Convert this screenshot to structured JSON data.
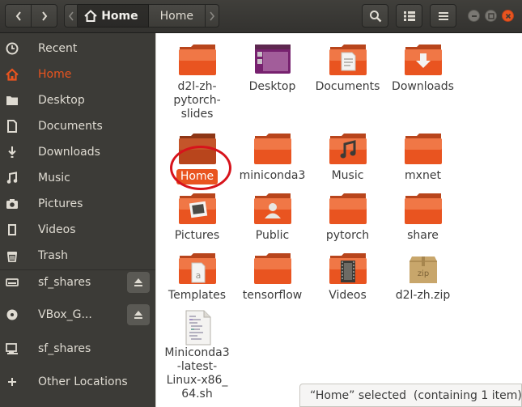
{
  "header": {
    "path_current": "Home",
    "path_next": "Home"
  },
  "sidebar": {
    "items": [
      {
        "label": "Recent",
        "icon": "clock-icon"
      },
      {
        "label": "Home",
        "icon": "home-icon"
      },
      {
        "label": "Desktop",
        "icon": "folder-icon"
      },
      {
        "label": "Documents",
        "icon": "document-icon"
      },
      {
        "label": "Downloads",
        "icon": "download-icon"
      },
      {
        "label": "Music",
        "icon": "music-icon"
      },
      {
        "label": "Pictures",
        "icon": "camera-icon"
      },
      {
        "label": "Videos",
        "icon": "video-icon"
      },
      {
        "label": "Trash",
        "icon": "trash-icon"
      },
      {
        "label": "sf_shares",
        "icon": "drive-icon"
      },
      {
        "label": "VBox_G...",
        "icon": "disc-icon"
      },
      {
        "label": "sf_shares",
        "icon": "network-drive-icon"
      },
      {
        "label": "Other Locations",
        "icon": "plus-icon"
      }
    ]
  },
  "files": [
    {
      "label": "d2l-zh-\npytorch-\nslides",
      "type": "folder"
    },
    {
      "label": "Desktop",
      "type": "desktop"
    },
    {
      "label": "Documents",
      "type": "documents"
    },
    {
      "label": "Downloads",
      "type": "downloads"
    },
    {
      "label": "Home",
      "type": "folder-selected"
    },
    {
      "label": "miniconda3",
      "type": "folder"
    },
    {
      "label": "Music",
      "type": "music"
    },
    {
      "label": "mxnet",
      "type": "folder"
    },
    {
      "label": "Pictures",
      "type": "pictures"
    },
    {
      "label": "Public",
      "type": "public"
    },
    {
      "label": "pytorch",
      "type": "folder"
    },
    {
      "label": "share",
      "type": "folder"
    },
    {
      "label": "Templates",
      "type": "templates"
    },
    {
      "label": "tensorflow",
      "type": "folder"
    },
    {
      "label": "Videos",
      "type": "videos"
    },
    {
      "label": "d2l-zh.zip",
      "type": "zip"
    },
    {
      "label": "Miniconda3\n-latest-\nLinux-x86_\n64.sh",
      "type": "script"
    }
  ],
  "status": "“Home” selected  (containing 1 item)",
  "colors": {
    "accent": "#e9541f",
    "sidebar_bg": "#3c3b37",
    "highlight_circle": "#d7131b"
  }
}
